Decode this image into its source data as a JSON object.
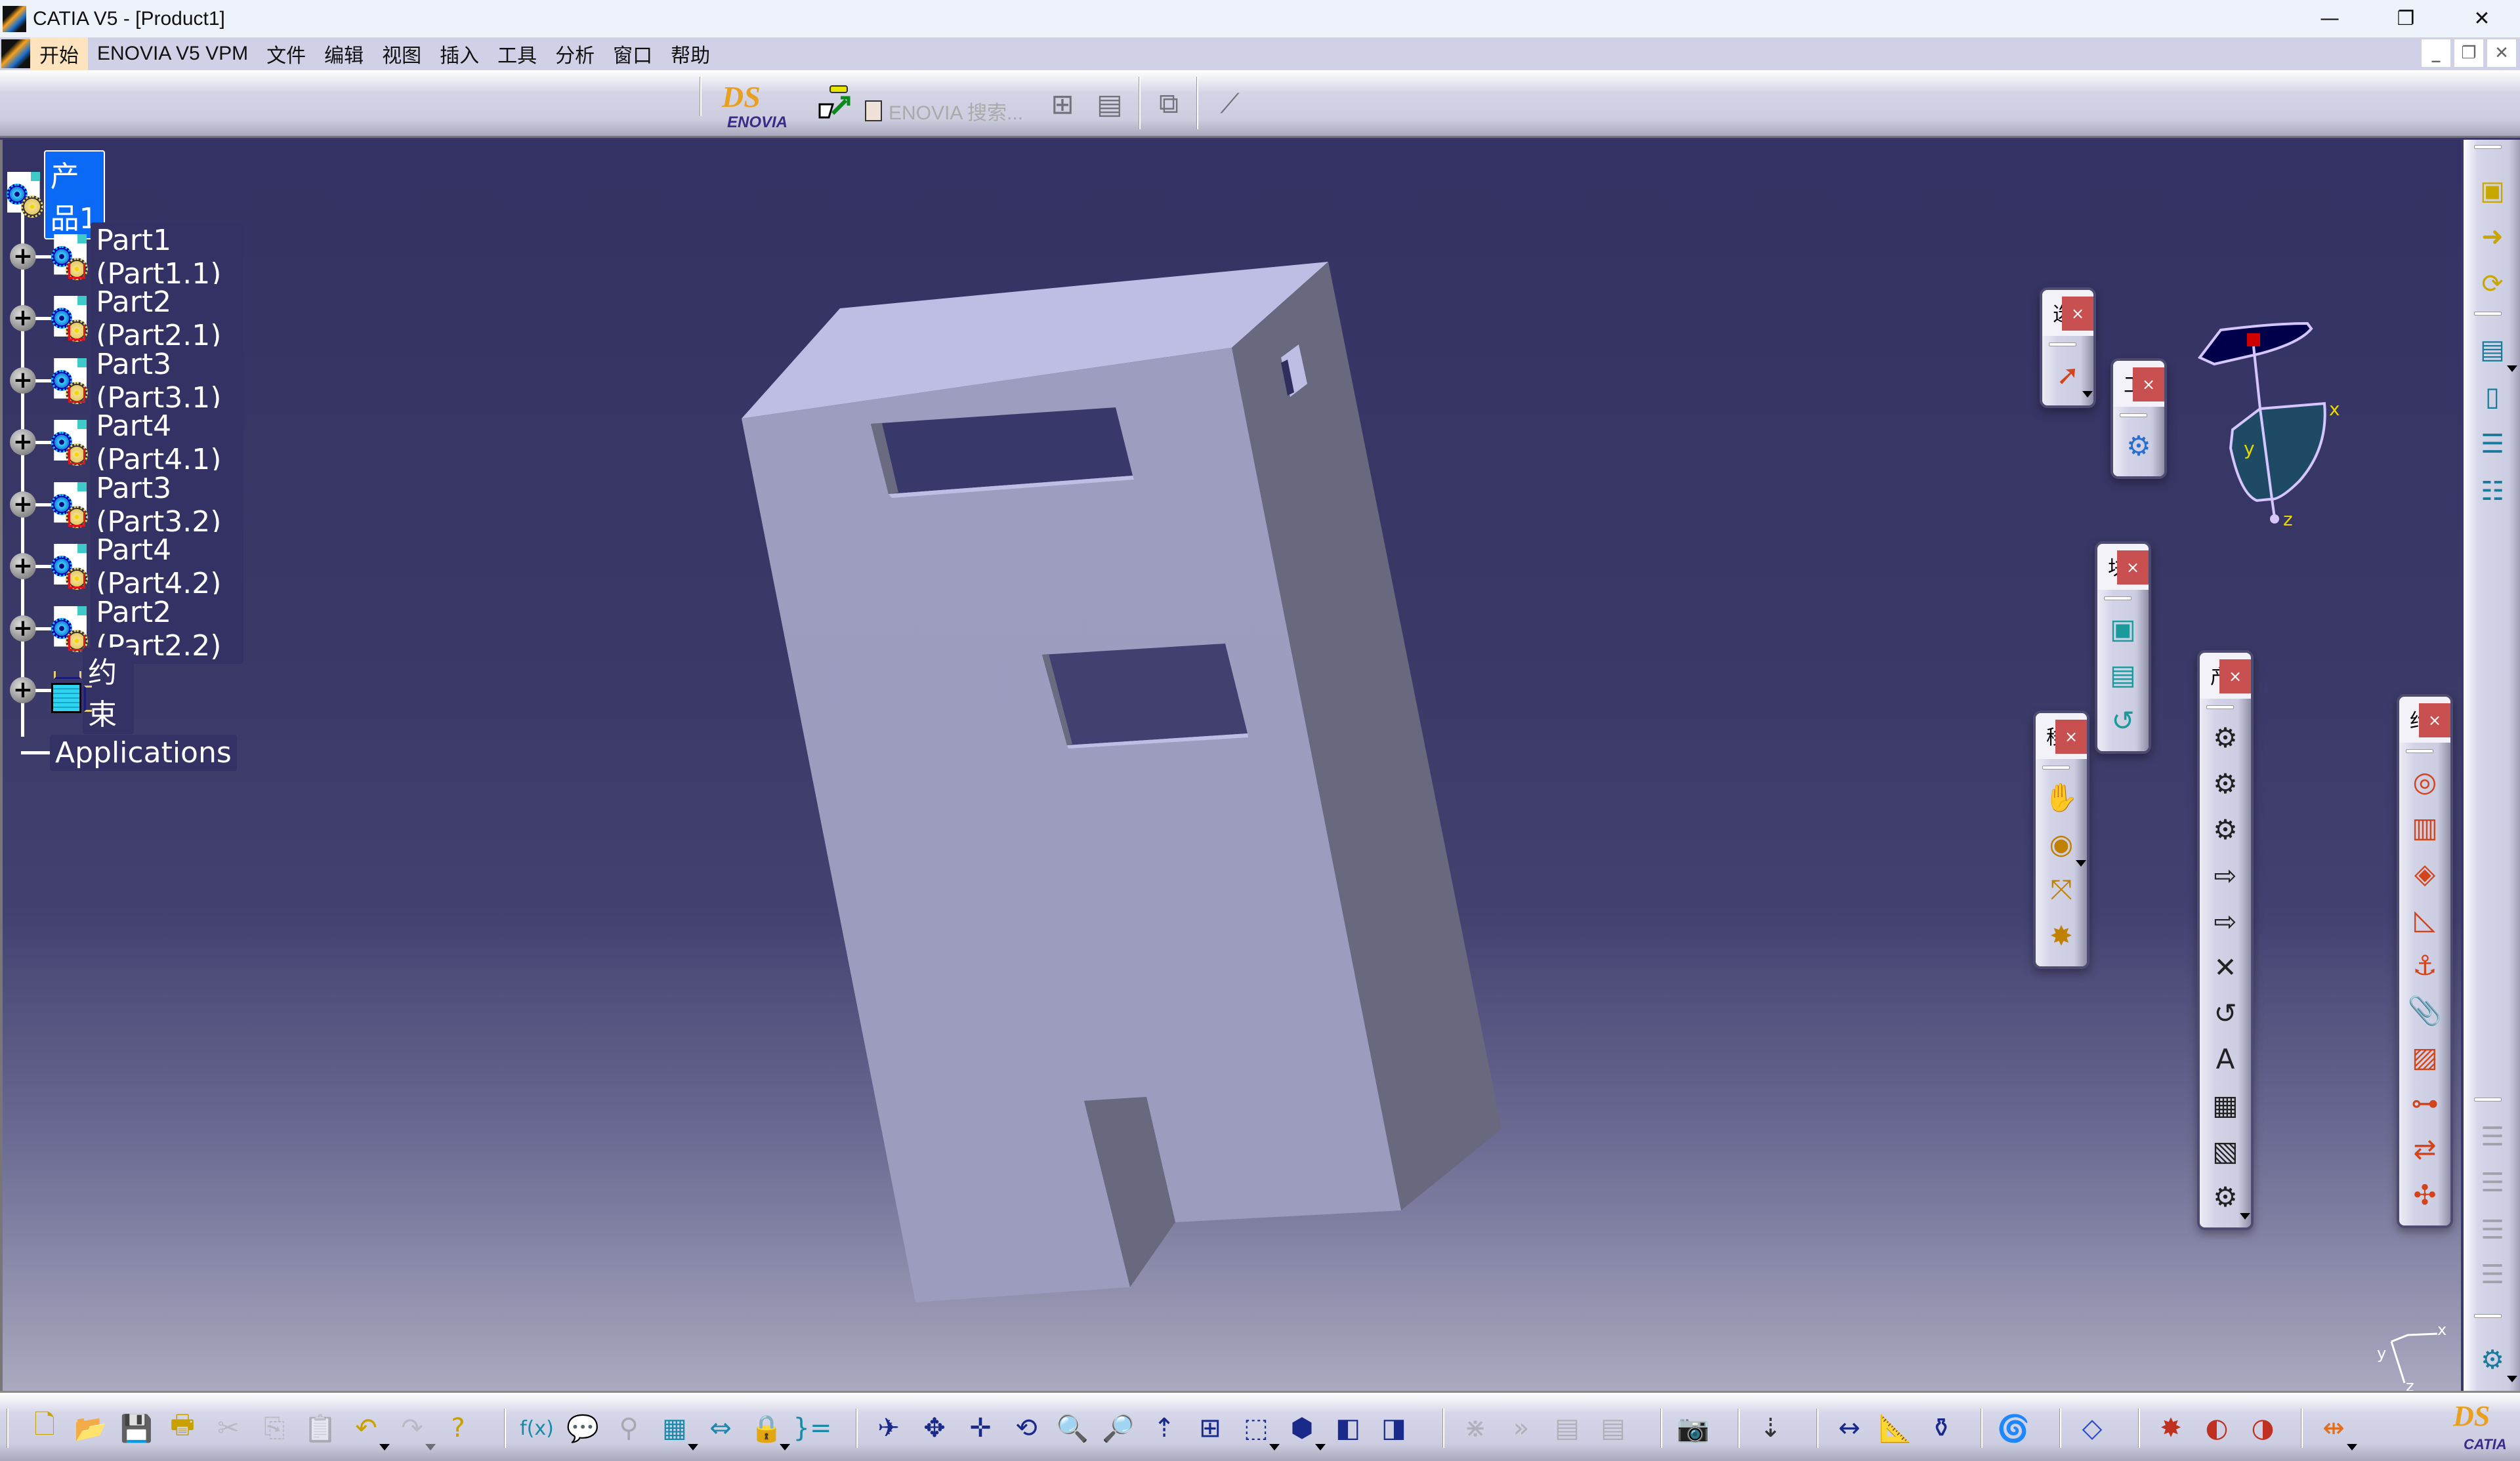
{
  "window": {
    "title": "CATIA V5 - [Product1]",
    "controls": {
      "minimize": "—",
      "restore": "❐",
      "close": "✕"
    }
  },
  "menubar": {
    "items": [
      "开始",
      "ENOVIA V5 VPM",
      "文件",
      "编辑",
      "视图",
      "插入",
      "工具",
      "分析",
      "窗口",
      "帮助"
    ],
    "active_index": 0,
    "doc_controls": {
      "minimize": "_",
      "restore": "❐",
      "close": "✕"
    }
  },
  "top_toolbar": {
    "enovia_logo": {
      "ds": "DS",
      "word": "ENOVIA"
    },
    "enovia_search_label": "ENOVIA 搜索...",
    "icons": [
      "enovia-connect-icon",
      "enovia-search-checkbox",
      "enovia-tree-icon",
      "enovia-save-icon",
      "enovia-sync-icon",
      "enovia-link-icon"
    ]
  },
  "tree": {
    "root": {
      "label": "产品1",
      "selected": true,
      "icon": "product-icon"
    },
    "children": [
      {
        "label": "Part1 (Part1.1)",
        "icon": "part-icon",
        "expandable": true
      },
      {
        "label": "Part2 (Part2.1)",
        "icon": "part-icon",
        "expandable": true
      },
      {
        "label": "Part3 (Part3.1)",
        "icon": "part-icon",
        "expandable": true
      },
      {
        "label": "Part4 (Part4.1)",
        "icon": "part-icon",
        "expandable": true
      },
      {
        "label": "Part3 (Part3.2)",
        "icon": "part-icon",
        "expandable": true
      },
      {
        "label": "Part4 (Part4.2)",
        "icon": "part-icon",
        "expandable": true
      },
      {
        "label": "Part2 (Part2.2)",
        "icon": "part-icon",
        "expandable": true
      },
      {
        "label": "约束",
        "icon": "constraints-icon",
        "expandable": true
      },
      {
        "label": "Applications",
        "icon": null,
        "expandable": false
      }
    ]
  },
  "compass": {
    "x_label": "x",
    "y_label": "y",
    "z_label": "z"
  },
  "mini_axis": {
    "x_label": "x",
    "y_label": "y",
    "z_label": "z"
  },
  "floating_toolbars": [
    {
      "id": "select",
      "title": "选择",
      "close": "×",
      "icons": [
        {
          "name": "select-arrow-icon",
          "glyph": "➚",
          "dropdown": true
        }
      ]
    },
    {
      "id": "tools",
      "title": "工具",
      "close": "×",
      "icons": [
        {
          "name": "gears-update-icon",
          "glyph": "⚙"
        }
      ]
    },
    {
      "id": "constraint-build",
      "title": "块",
      "close": "×",
      "icons": [
        {
          "name": "fix-together-icon",
          "glyph": "▣"
        },
        {
          "name": "smart-move-icon",
          "glyph": "▤"
        },
        {
          "name": "reorder-icon",
          "glyph": "↺"
        }
      ]
    },
    {
      "id": "move",
      "title": "移动",
      "close": "×",
      "icons": [
        {
          "name": "manipulation-icon",
          "glyph": "✋"
        },
        {
          "name": "snap-icon",
          "glyph": "◉",
          "dropdown": true
        },
        {
          "name": "explode-icon",
          "glyph": "⤧"
        },
        {
          "name": "stop-manipulate-icon",
          "glyph": "✸"
        }
      ]
    },
    {
      "id": "product-structure",
      "title": "产品结构工具",
      "close": "×",
      "icons": [
        {
          "name": "new-component-icon",
          "glyph": "⚙"
        },
        {
          "name": "new-product-icon",
          "glyph": "⚙"
        },
        {
          "name": "new-part-icon",
          "glyph": "⚙"
        },
        {
          "name": "existing-component-icon",
          "glyph": "⇨"
        },
        {
          "name": "existing-component-positioning-icon",
          "glyph": "⇨"
        },
        {
          "name": "replace-component-icon",
          "glyph": "✕"
        },
        {
          "name": "graph-tree-reordering-icon",
          "glyph": "↺"
        },
        {
          "name": "generate-numbering-icon",
          "glyph": "A"
        },
        {
          "name": "selective-load-icon",
          "glyph": "▦"
        },
        {
          "name": "manage-representations-icon",
          "glyph": "▧"
        },
        {
          "name": "multi-instantiation-icon",
          "glyph": "⚙",
          "dropdown": true
        }
      ]
    },
    {
      "id": "constraints",
      "title": "约束",
      "close": "×",
      "icons": [
        {
          "name": "coincidence-constraint-icon",
          "glyph": "◎"
        },
        {
          "name": "contact-constraint-icon",
          "glyph": "▥"
        },
        {
          "name": "offset-constraint-icon",
          "glyph": "◈"
        },
        {
          "name": "angle-constraint-icon",
          "glyph": "◺"
        },
        {
          "name": "fix-component-icon",
          "glyph": "⚓"
        },
        {
          "name": "fix-together-clip-icon",
          "glyph": "📎"
        },
        {
          "name": "quick-constraint-icon",
          "glyph": "▨"
        },
        {
          "name": "flexible-rigid-icon",
          "glyph": "⊶"
        },
        {
          "name": "change-constraint-icon",
          "glyph": "⇄"
        },
        {
          "name": "reuse-pattern-icon",
          "glyph": "✣"
        }
      ]
    }
  ],
  "right_toolbar": {
    "icons": [
      {
        "name": "catalog-browser-icon",
        "glyph": "▣"
      },
      {
        "name": "catalog-add-icon",
        "glyph": "➜"
      },
      {
        "name": "catalog-link-icon",
        "glyph": "⟳"
      },
      {
        "name": "scenes-icon",
        "glyph": "▤",
        "dropdown": true
      },
      {
        "name": "enhanced-scene-icon",
        "glyph": "▯"
      },
      {
        "name": "tree-expand-icon",
        "glyph": "☰"
      },
      {
        "name": "tree-collapse-icon",
        "glyph": "☷"
      },
      {
        "name": "disabled-tree-1-icon",
        "glyph": "☰",
        "disabled": true
      },
      {
        "name": "disabled-tree-2-icon",
        "glyph": "☰",
        "disabled": true
      },
      {
        "name": "disabled-tree-3-icon",
        "glyph": "☰",
        "disabled": true
      },
      {
        "name": "disabled-tree-4-icon",
        "glyph": "☰",
        "disabled": true
      },
      {
        "name": "select-settings-icon",
        "glyph": "⚙",
        "dropdown": true
      }
    ]
  },
  "bottom_toolbar": {
    "groups": [
      [
        {
          "name": "new-icon",
          "glyph": "🗋"
        },
        {
          "name": "open-icon",
          "glyph": "📂"
        },
        {
          "name": "save-icon",
          "glyph": "💾"
        },
        {
          "name": "print-icon",
          "glyph": "🖶"
        },
        {
          "name": "cut-icon",
          "glyph": "✂",
          "disabled": true
        },
        {
          "name": "copy-icon",
          "glyph": "⎘",
          "disabled": true
        },
        {
          "name": "paste-icon",
          "glyph": "📋",
          "disabled": true
        },
        {
          "name": "undo-icon",
          "glyph": "↶",
          "dropdown": true
        },
        {
          "name": "redo-icon",
          "glyph": "↷",
          "dropdown": true,
          "disabled": true
        },
        {
          "name": "whats-this-icon",
          "glyph": "?"
        }
      ],
      [
        {
          "name": "formula-icon",
          "glyph": "f(x)"
        },
        {
          "name": "comment-icon",
          "glyph": "💬"
        },
        {
          "name": "knowledge-disabled-icon",
          "glyph": "⚲",
          "disabled": true
        },
        {
          "name": "design-table-icon",
          "glyph": "▦",
          "dropdown": true
        },
        {
          "name": "relations-icon",
          "glyph": "⇔"
        },
        {
          "name": "lock-icon",
          "glyph": "🔒",
          "dropdown": true
        },
        {
          "name": "equivalent-icon",
          "glyph": "}="
        }
      ],
      [
        {
          "name": "fly-mode-icon",
          "glyph": "✈"
        },
        {
          "name": "fit-all-icon",
          "glyph": "✥"
        },
        {
          "name": "pan-icon",
          "glyph": "✛"
        },
        {
          "name": "rotate-icon",
          "glyph": "⟲"
        },
        {
          "name": "zoom-in-icon",
          "glyph": "🔍"
        },
        {
          "name": "zoom-out-icon",
          "glyph": "🔎"
        },
        {
          "name": "normal-view-icon",
          "glyph": "⇡"
        },
        {
          "name": "multi-view-icon",
          "glyph": "⊞"
        },
        {
          "name": "iso-view-icon",
          "glyph": "⬚",
          "dropdown": true
        },
        {
          "name": "shading-icon",
          "glyph": "⬢",
          "dropdown": true
        },
        {
          "name": "hide-show-icon",
          "glyph": "◧"
        },
        {
          "name": "swap-visible-icon",
          "glyph": "◨"
        }
      ],
      [
        {
          "name": "disabled-1-icon",
          "glyph": "⋇",
          "disabled": true
        },
        {
          "name": "disabled-2-icon",
          "glyph": "»",
          "disabled": true
        },
        {
          "name": "disabled-3-icon",
          "glyph": "▤",
          "disabled": true
        },
        {
          "name": "disabled-4-icon",
          "glyph": "▤",
          "disabled": true
        }
      ],
      [
        {
          "name": "capture-icon",
          "glyph": "📷"
        }
      ],
      [
        {
          "name": "update-icon",
          "glyph": "⇣"
        }
      ],
      [
        {
          "name": "measure-between-icon",
          "glyph": "↔"
        },
        {
          "name": "measure-item-icon",
          "glyph": "📐"
        },
        {
          "name": "measure-inertia-icon",
          "glyph": "⚱"
        }
      ],
      [
        {
          "name": "clash-analysis-icon",
          "glyph": "🌀"
        }
      ],
      [
        {
          "name": "sectioning-icon",
          "glyph": "◇"
        }
      ],
      [
        {
          "name": "apply-material-icon",
          "glyph": "✸"
        },
        {
          "name": "render-icon",
          "glyph": "◐"
        },
        {
          "name": "color-icon",
          "glyph": "◑"
        }
      ],
      [
        {
          "name": "snap-grid-icon",
          "glyph": "⇹",
          "dropdown": true
        }
      ]
    ],
    "catia_logo": {
      "ds": "DS",
      "word": "CATIA"
    }
  }
}
